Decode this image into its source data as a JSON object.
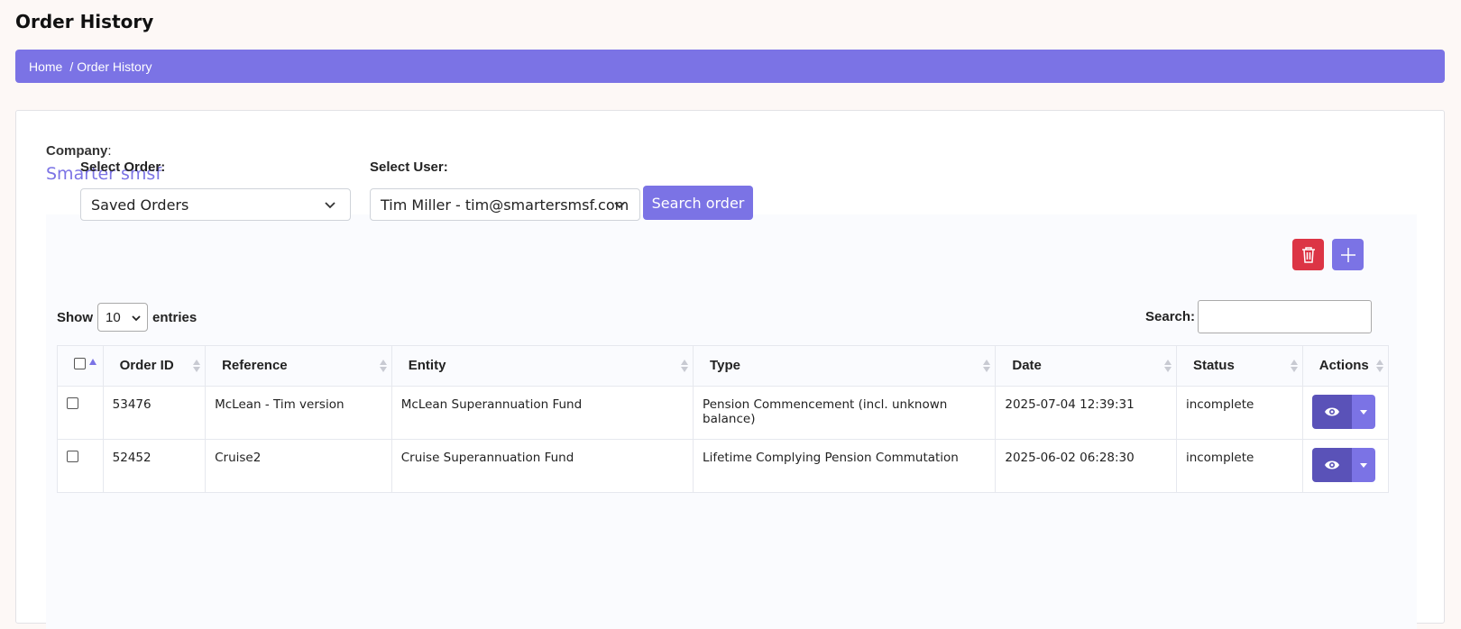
{
  "page": {
    "title": "Order History"
  },
  "breadcrumb": {
    "home": "Home",
    "separator": "/",
    "current": "Order History"
  },
  "company": {
    "label": "Company",
    "colon": ":",
    "name": "Smarter smsf"
  },
  "filters": {
    "order_label": "Select Order:",
    "order_value": "Saved Orders",
    "user_label": "Select User:",
    "user_value": "Tim Miller - tim@smartersmsf.com",
    "search_button": "Search order"
  },
  "table_controls": {
    "show_label": "Show",
    "entries_value": "10",
    "entries_label": "entries",
    "search_label": "Search:"
  },
  "table": {
    "headers": [
      "Order ID",
      "Reference",
      "Entity",
      "Type",
      "Date",
      "Status",
      "Actions"
    ],
    "rows": [
      {
        "order_id": "53476",
        "reference": "McLean - Tim version",
        "entity": "McLean Superannuation Fund",
        "type": "Pension Commencement (incl. unknown balance)",
        "date": "2025-07-04 12:39:31",
        "status": "incomplete"
      },
      {
        "order_id": "52452",
        "reference": "Cruise2",
        "entity": "Cruise Superannuation Fund",
        "type": "Lifetime Complying Pension Commutation",
        "date": "2025-06-02 06:28:30",
        "status": "incomplete"
      }
    ]
  },
  "colors": {
    "accent": "#7b73e5",
    "accent_dark": "#5a52b8",
    "danger": "#dc3545"
  }
}
